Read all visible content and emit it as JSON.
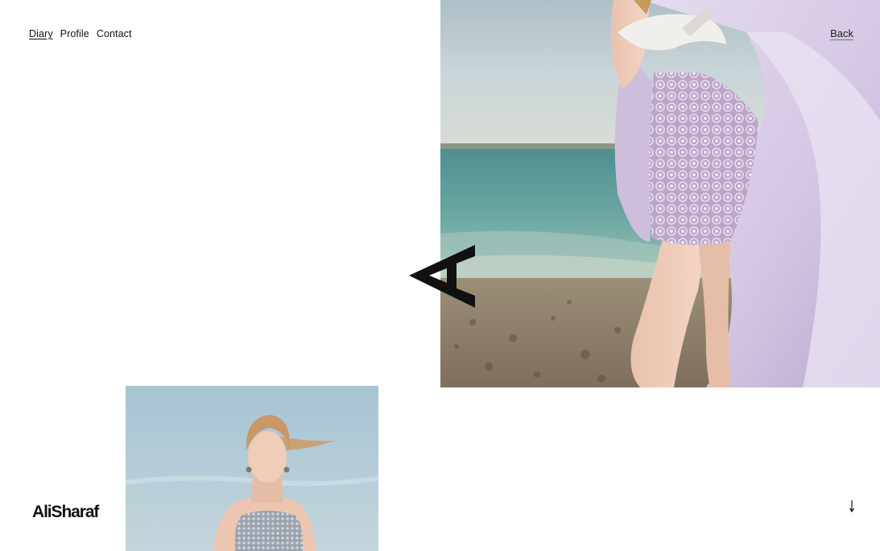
{
  "nav": {
    "items": [
      {
        "label": "Diary",
        "active": true
      },
      {
        "label": "Profile",
        "active": false
      },
      {
        "label": "Contact",
        "active": false
      }
    ]
  },
  "back_label": "Back",
  "brand": {
    "name": "AliSharaf"
  },
  "icons": {
    "logo_mark": "rotated-letter-a-logo-icon",
    "scroll": "arrow-down-icon"
  },
  "colors": {
    "text": "#111111",
    "background": "#ffffff",
    "sky": "#bfd0d8",
    "sea": "#5f9c98",
    "dress": "#d8cde6"
  }
}
